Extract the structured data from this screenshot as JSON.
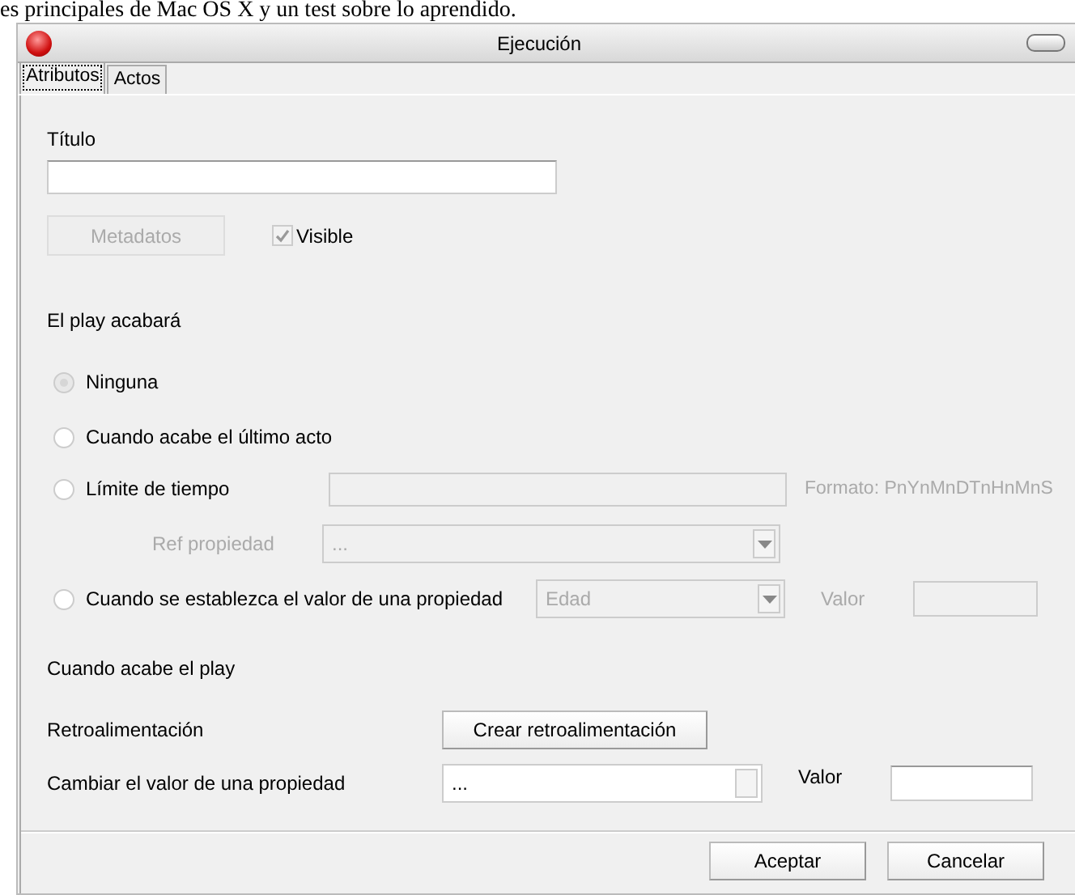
{
  "background_text": "es principales de Mac OS X y un test sobre lo aprendido.",
  "window": {
    "title": "Ejecución"
  },
  "tabs": [
    {
      "label": "Atributos",
      "selected": true
    },
    {
      "label": "Actos",
      "selected": false
    }
  ],
  "title_field": {
    "label": "Título"
  },
  "metadata_button": {
    "label": "Metadatos",
    "disabled": true
  },
  "visible_checkbox": {
    "label": "Visible",
    "checked": true,
    "disabled": true
  },
  "end_section": {
    "heading": "El play acabará",
    "options": [
      {
        "kind": "plain",
        "label": "Ninguna",
        "selected": true
      },
      {
        "kind": "plain",
        "label": "Cuando acabe el último acto",
        "selected": false
      },
      {
        "kind": "time",
        "label": "Límite de tiempo",
        "selected": false,
        "field": {
          "disabled": true
        },
        "format_hint": "Formato: PnYnMnDTnHnMnS",
        "ref": {
          "label": "Ref propiedad",
          "value": "...",
          "disabled": true
        }
      },
      {
        "kind": "property",
        "label": "Cuando se establezca el valor de una propiedad",
        "selected": false,
        "property": {
          "value": "Edad",
          "disabled": true
        },
        "value_field": {
          "label": "Valor",
          "disabled": true
        }
      }
    ]
  },
  "after_section": {
    "heading": "Cuando acabe el play",
    "feedback_label": "Retroalimentación",
    "feedback_button": "Crear retroalimentación",
    "change_label": "Cambiar el valor de una propiedad",
    "change_value": "...",
    "value_label": "Valor"
  },
  "buttons": [
    "Aceptar",
    "Cancelar"
  ]
}
